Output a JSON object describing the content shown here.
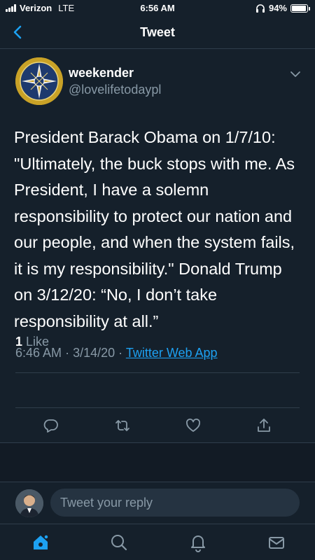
{
  "status_bar": {
    "carrier": "Verizon",
    "network": "LTE",
    "time": "6:56 AM",
    "battery": "94%",
    "battery_level": 0.94,
    "icons": [
      "signal-icon",
      "headphones-icon",
      "battery-icon"
    ]
  },
  "nav": {
    "title": "Tweet",
    "back_icon": "chevron-left-icon"
  },
  "tweet": {
    "display_name": "weekender",
    "handle": "@lovelifetodaypl",
    "text": "President Barack Obama on 1/7/10: \"Ultimately, the buck stops with me. As President, I have a solemn responsibility to protect our nation and our people, and when the system fails, it is my responsibility.\" Donald Trump on 3/12/20: “No, I don’t take responsibility at all.”",
    "time": "6:46 AM",
    "date": "3/14/20",
    "source": "Twitter Web App",
    "like_count": "1",
    "like_label": "Like",
    "actions": [
      "reply-icon",
      "retweet-icon",
      "like-icon",
      "share-icon"
    ]
  },
  "reply": {
    "placeholder": "Tweet your reply"
  },
  "tab_bar": {
    "items": [
      "home-icon",
      "search-icon",
      "notifications-icon",
      "messages-icon"
    ]
  },
  "colors": {
    "background": "#15202b",
    "accent": "#1da1f2",
    "secondary_text": "#8899a6",
    "divider": "#2f3d4b"
  }
}
